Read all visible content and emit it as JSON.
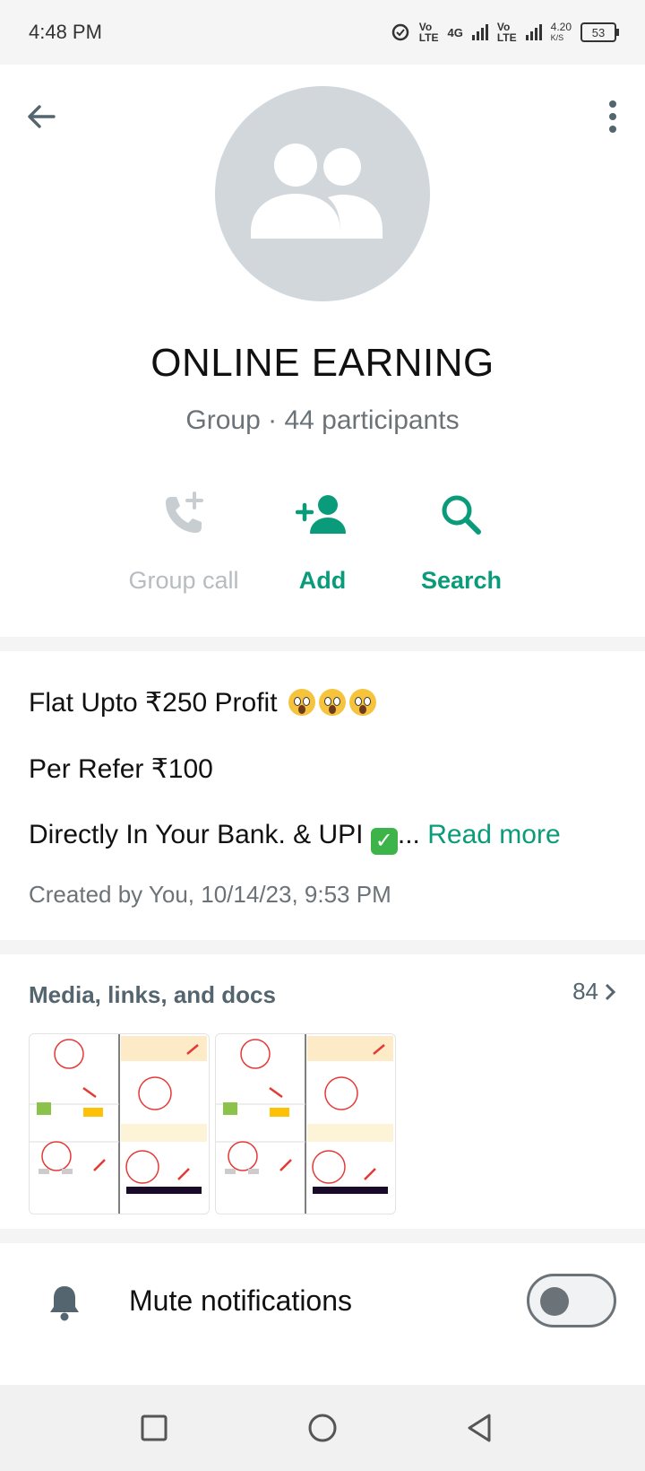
{
  "status_bar": {
    "time": "4:48 PM",
    "net1_top": "Vo",
    "net1_bottom": "LTE",
    "net_4g": "4G",
    "net2_top": "Vo",
    "net2_bottom": "LTE",
    "speed_top": "4.20",
    "speed_bottom": "K/S",
    "battery": "53"
  },
  "header": {
    "group_name": "ONLINE EARNING",
    "subtitle": "Group · 44 participants",
    "actions": [
      {
        "label": "Group call",
        "icon": "phone-add-icon",
        "enabled": false
      },
      {
        "label": "Add",
        "icon": "add-person-icon",
        "enabled": true
      },
      {
        "label": "Search",
        "icon": "search-icon",
        "enabled": true
      }
    ]
  },
  "description": {
    "line1": "Flat Upto ₹250 Profit",
    "line2": "Per Refer ₹100",
    "line3": "Directly In Your Bank. & UPI",
    "ellipsis": "...",
    "read_more": "Read more",
    "created": "Created by You, 10/14/23, 9:53 PM"
  },
  "media": {
    "title": "Media, links, and docs",
    "count": "84"
  },
  "mute": {
    "label": "Mute notifications",
    "enabled": false
  },
  "colors": {
    "accent": "#0a9c7a",
    "avatar_bg": "#d1d7db",
    "muted_text": "#6b7378"
  }
}
